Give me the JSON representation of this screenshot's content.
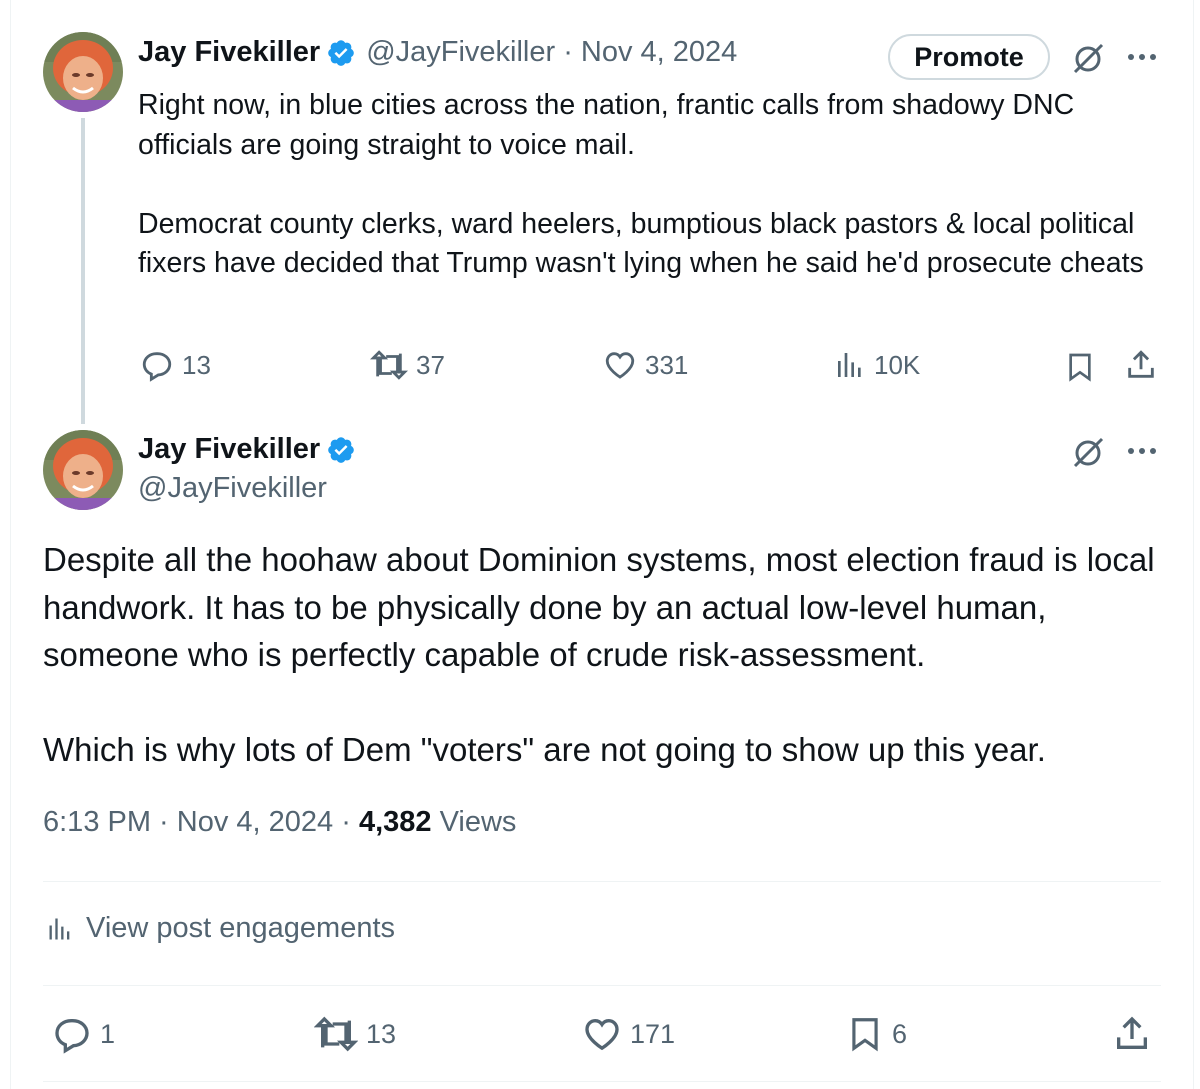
{
  "tweet1": {
    "name": "Jay Fivekiller",
    "handle_date": "@JayFivekiller · Nov 4, 2024",
    "promote_label": "Promote",
    "paragraphs": [
      "Right now, in blue cities across the nation, frantic calls from shadowy DNC officials are going straight to voice mail.",
      "Democrat county clerks, ward heelers, bumptious black pastors & local political fixers have decided that Trump wasn't lying when he said he'd prosecute cheats"
    ],
    "actions": {
      "replies": "13",
      "reposts": "37",
      "likes": "331",
      "views": "10K"
    }
  },
  "tweet2": {
    "name": "Jay Fivekiller",
    "handle": "@JayFivekiller",
    "paragraphs": [
      "Despite all the hoohaw about Dominion systems, most election fraud is local handwork. It has to be physically done by an actual low-level human, someone who is perfectly capable of crude risk-assessment.",
      "Which is why lots of Dem \"voters\" are not going to show up this year."
    ],
    "time_date": "6:13 PM · Nov 4, 2024 · ",
    "views_count": "4,382",
    "views_label": " Views",
    "engagements_label": "View post engagements",
    "actions": {
      "replies": "1",
      "reposts": "13",
      "likes": "171",
      "bookmarks": "6"
    }
  },
  "colors": {
    "text": "#0f1419",
    "secondary": "#536471",
    "verified": "#1d9bf0",
    "border": "#eff3f4"
  },
  "icons": [
    "reply-icon",
    "repost-icon",
    "like-icon",
    "views-icon",
    "bookmark-icon",
    "share-icon",
    "grok-icon",
    "more-icon",
    "verified-badge-icon"
  ]
}
